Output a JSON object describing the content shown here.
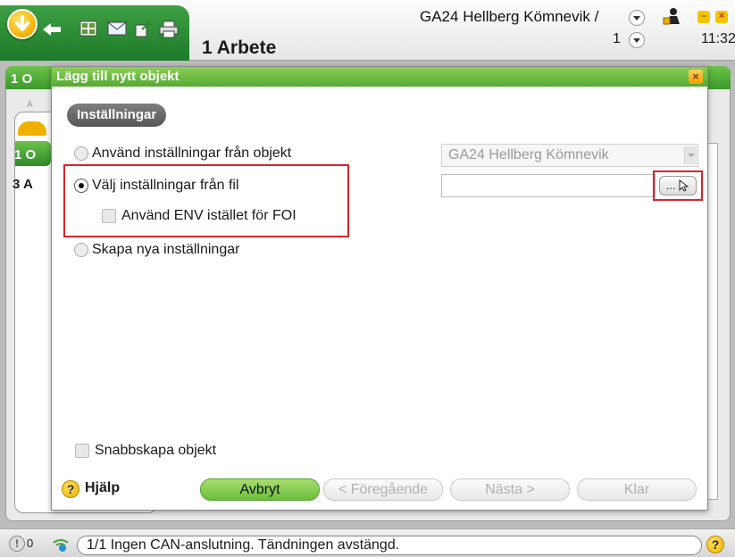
{
  "app": {
    "title": "1 Arbete",
    "vehicle": "GA24 Hellberg Kömnevik /",
    "page": "1",
    "clock": "11:32"
  },
  "background": {
    "header_label": "1 O",
    "card_label_1": "1 O",
    "card_label_2": "3 A",
    "card_small": "A"
  },
  "dialog": {
    "title": "Lägg till nytt objekt",
    "close_symbol": "×",
    "section_label": "Inställningar",
    "options": {
      "use_from_object": "Använd inställningar från objekt",
      "choose_from_file": "Välj inställningar från fil",
      "use_env": "Använd ENV istället för FOI",
      "create_new": "Skapa nya inställningar"
    },
    "selected_option": "choose_from_file",
    "object_select_value": "GA24 Hellberg Kömnevik",
    "file_input_value": "",
    "browse_label": "...",
    "quick_create": "Snabbskapa objekt",
    "help_label": "Hjälp",
    "help_symbol": "?",
    "buttons": {
      "cancel": "Avbryt",
      "previous": "< Föregående",
      "next": "Nästa >",
      "finish": "Klar"
    }
  },
  "statusbar": {
    "counter": "0",
    "message": "1/1 Ingen CAN-anslutning. Tändningen avstängd.",
    "help_symbol": "?"
  },
  "colors": {
    "accent_green": "#55a933",
    "highlight_red": "#d6252e",
    "warning_yellow": "#f0b000"
  },
  "icons": [
    "down-arrow-icon",
    "back-arrow-icon",
    "grid-icon",
    "mail-icon",
    "export-icon",
    "print-icon",
    "user-icon",
    "minimize-icon",
    "close-icon",
    "help-icon",
    "warning-icon",
    "wifi-icon"
  ]
}
